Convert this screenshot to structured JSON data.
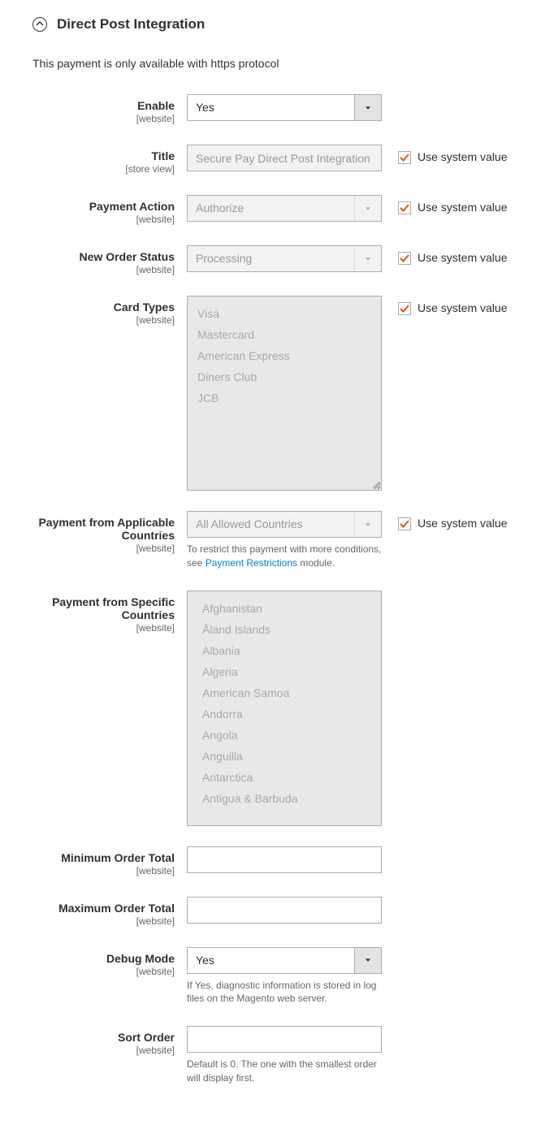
{
  "section": {
    "title": "Direct Post Integration",
    "notice": "This payment is only available with https protocol"
  },
  "scopes": {
    "website": "[website]",
    "store_view": "[store view]"
  },
  "use_system_value_label": "Use system value",
  "fields": {
    "enable": {
      "label": "Enable",
      "value": "Yes"
    },
    "title": {
      "label": "Title",
      "value": "Secure Pay Direct Post Integration"
    },
    "payment_action": {
      "label": "Payment Action",
      "value": "Authorize"
    },
    "new_order_status": {
      "label": "New Order Status",
      "value": "Processing"
    },
    "card_types": {
      "label": "Card Types",
      "options_0": "Visa",
      "options_1": "Mastercard",
      "options_2": "American Express",
      "options_3": "Diners Club",
      "options_4": "JCB"
    },
    "payment_applicable": {
      "label": "Payment from Applicable Countries",
      "value": "All Allowed Countries",
      "help_prefix": "To restrict this payment with more conditions, see ",
      "help_link": "Payment Restrictions",
      "help_suffix": " module."
    },
    "payment_specific": {
      "label": "Payment from Specific Countries",
      "options_0": "Afghanistan",
      "options_1": "Åland Islands",
      "options_2": "Albania",
      "options_3": "Algeria",
      "options_4": "American Samoa",
      "options_5": "Andorra",
      "options_6": "Angola",
      "options_7": "Anguilla",
      "options_8": "Antarctica",
      "options_9": "Antigua & Barbuda"
    },
    "min_order": {
      "label": "Minimum Order Total",
      "value": ""
    },
    "max_order": {
      "label": "Maximum Order Total",
      "value": ""
    },
    "debug_mode": {
      "label": "Debug Mode",
      "value": "Yes",
      "help": "If Yes, diagnostic information is stored in log files on the Magento web server."
    },
    "sort_order": {
      "label": "Sort Order",
      "value": "",
      "help": "Default is 0. The one with the smallest order will display first."
    }
  }
}
